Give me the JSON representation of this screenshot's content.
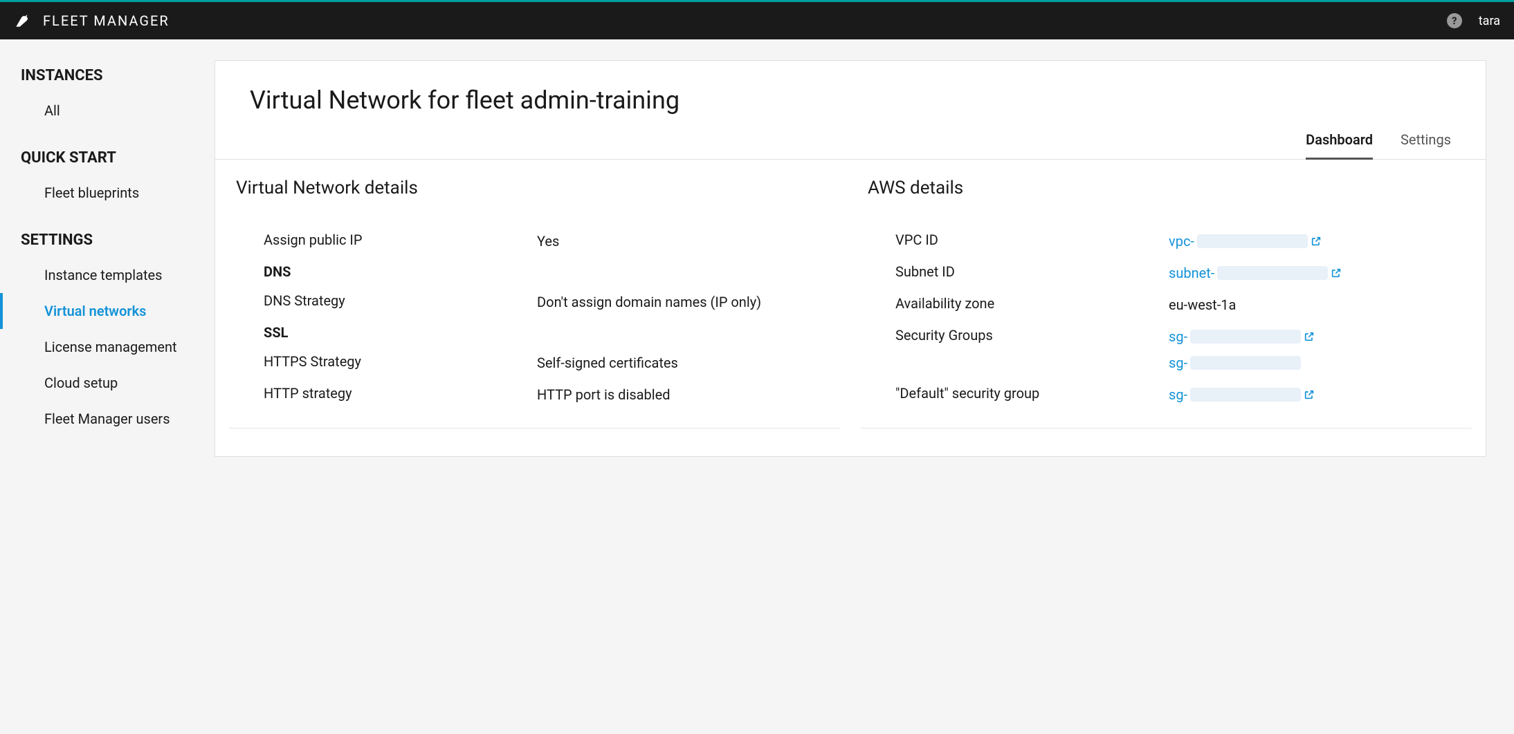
{
  "header": {
    "app_title": "FLEET MANAGER",
    "username": "tara"
  },
  "sidebar": {
    "instances_heading": "INSTANCES",
    "all_label": "All",
    "quickstart_heading": "QUICK START",
    "fleet_blueprints": "Fleet blueprints",
    "settings_heading": "SETTINGS",
    "instance_templates": "Instance templates",
    "virtual_networks": "Virtual networks",
    "license_management": "License management",
    "cloud_setup": "Cloud setup",
    "fleet_manager_users": "Fleet Manager users"
  },
  "page": {
    "title": "Virtual Network for fleet admin-training",
    "tab_dashboard": "Dashboard",
    "tab_settings": "Settings"
  },
  "vn_details": {
    "title": "Virtual Network details",
    "assign_public_ip_label": "Assign public IP",
    "assign_public_ip_value": "Yes",
    "dns_heading": "DNS",
    "dns_strategy_label": "DNS Strategy",
    "dns_strategy_value": "Don't assign domain names (IP only)",
    "ssl_heading": "SSL",
    "https_strategy_label": "HTTPS Strategy",
    "https_strategy_value": "Self-signed certificates",
    "http_strategy_label": "HTTP strategy",
    "http_strategy_value": "HTTP port is disabled"
  },
  "aws_details": {
    "title": "AWS details",
    "vpc_id_label": "VPC ID",
    "vpc_id_prefix": "vpc-",
    "subnet_id_label": "Subnet ID",
    "subnet_id_prefix": "subnet-",
    "availability_zone_label": "Availability zone",
    "availability_zone_value": "eu-west-1a",
    "security_groups_label": "Security Groups",
    "sg1_prefix": "sg-",
    "sg2_prefix": "sg-",
    "default_sg_label": "\"Default\" security group",
    "default_sg_prefix": "sg-"
  }
}
